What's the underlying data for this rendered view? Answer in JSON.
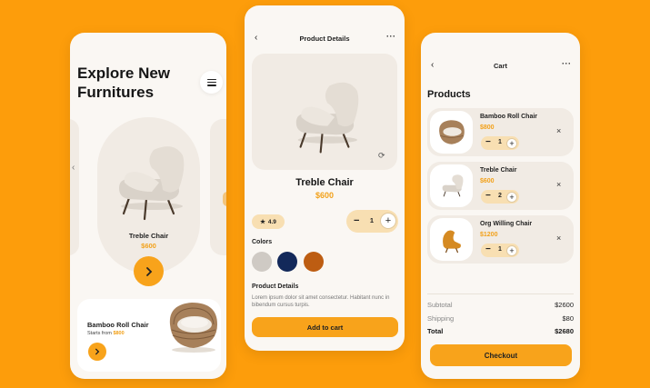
{
  "colors": {
    "background": "#fd9d0b",
    "accent": "#f8a31b",
    "price": "#f2a11a",
    "card": "#f1ebe4"
  },
  "explore": {
    "title": "Explore New Furnitures",
    "menu_icon": "hamburger-menu-icon",
    "featured": {
      "name": "Treble Chair",
      "price": "$600",
      "icon": "chevron-right-icon"
    },
    "promo": {
      "name": "Bamboo Roll Chair",
      "starts_prefix": "Starts from",
      "price": "$800",
      "icon": "chevron-right-icon"
    }
  },
  "details": {
    "title": "Product Details",
    "back_icon": "back-arrow-icon",
    "more_icon": "more-dots-icon",
    "view360_icon": "rotate-360-icon",
    "product_name": "Treble Chair",
    "price": "$600",
    "rating": "4.9",
    "quantity": "1",
    "colors_label": "Colors",
    "colors": [
      "#cfcac4",
      "#13295a",
      "#bd5d12"
    ],
    "details_label": "Product Details",
    "description": "Lorem ipsum dolor sit amet consectetur. Habitant nunc in bibendum cursus turpis.",
    "add_to_cart": "Add to cart"
  },
  "cart": {
    "title": "Cart",
    "back_icon": "back-arrow-icon",
    "more_icon": "more-dots-icon",
    "section_title": "Products",
    "items": [
      {
        "name": "Bamboo Roll Chair",
        "price": "$800",
        "quantity": "1"
      },
      {
        "name": "Treble Chair",
        "price": "$600",
        "quantity": "2"
      },
      {
        "name": "Org Willing Chair",
        "price": "$1200",
        "quantity": "1"
      }
    ],
    "summary": {
      "subtotal_label": "Subtotal",
      "subtotal": "$2600",
      "shipping_label": "Shipping",
      "shipping": "$80",
      "total_label": "Total",
      "total": "$2680"
    },
    "checkout": "Checkout"
  }
}
